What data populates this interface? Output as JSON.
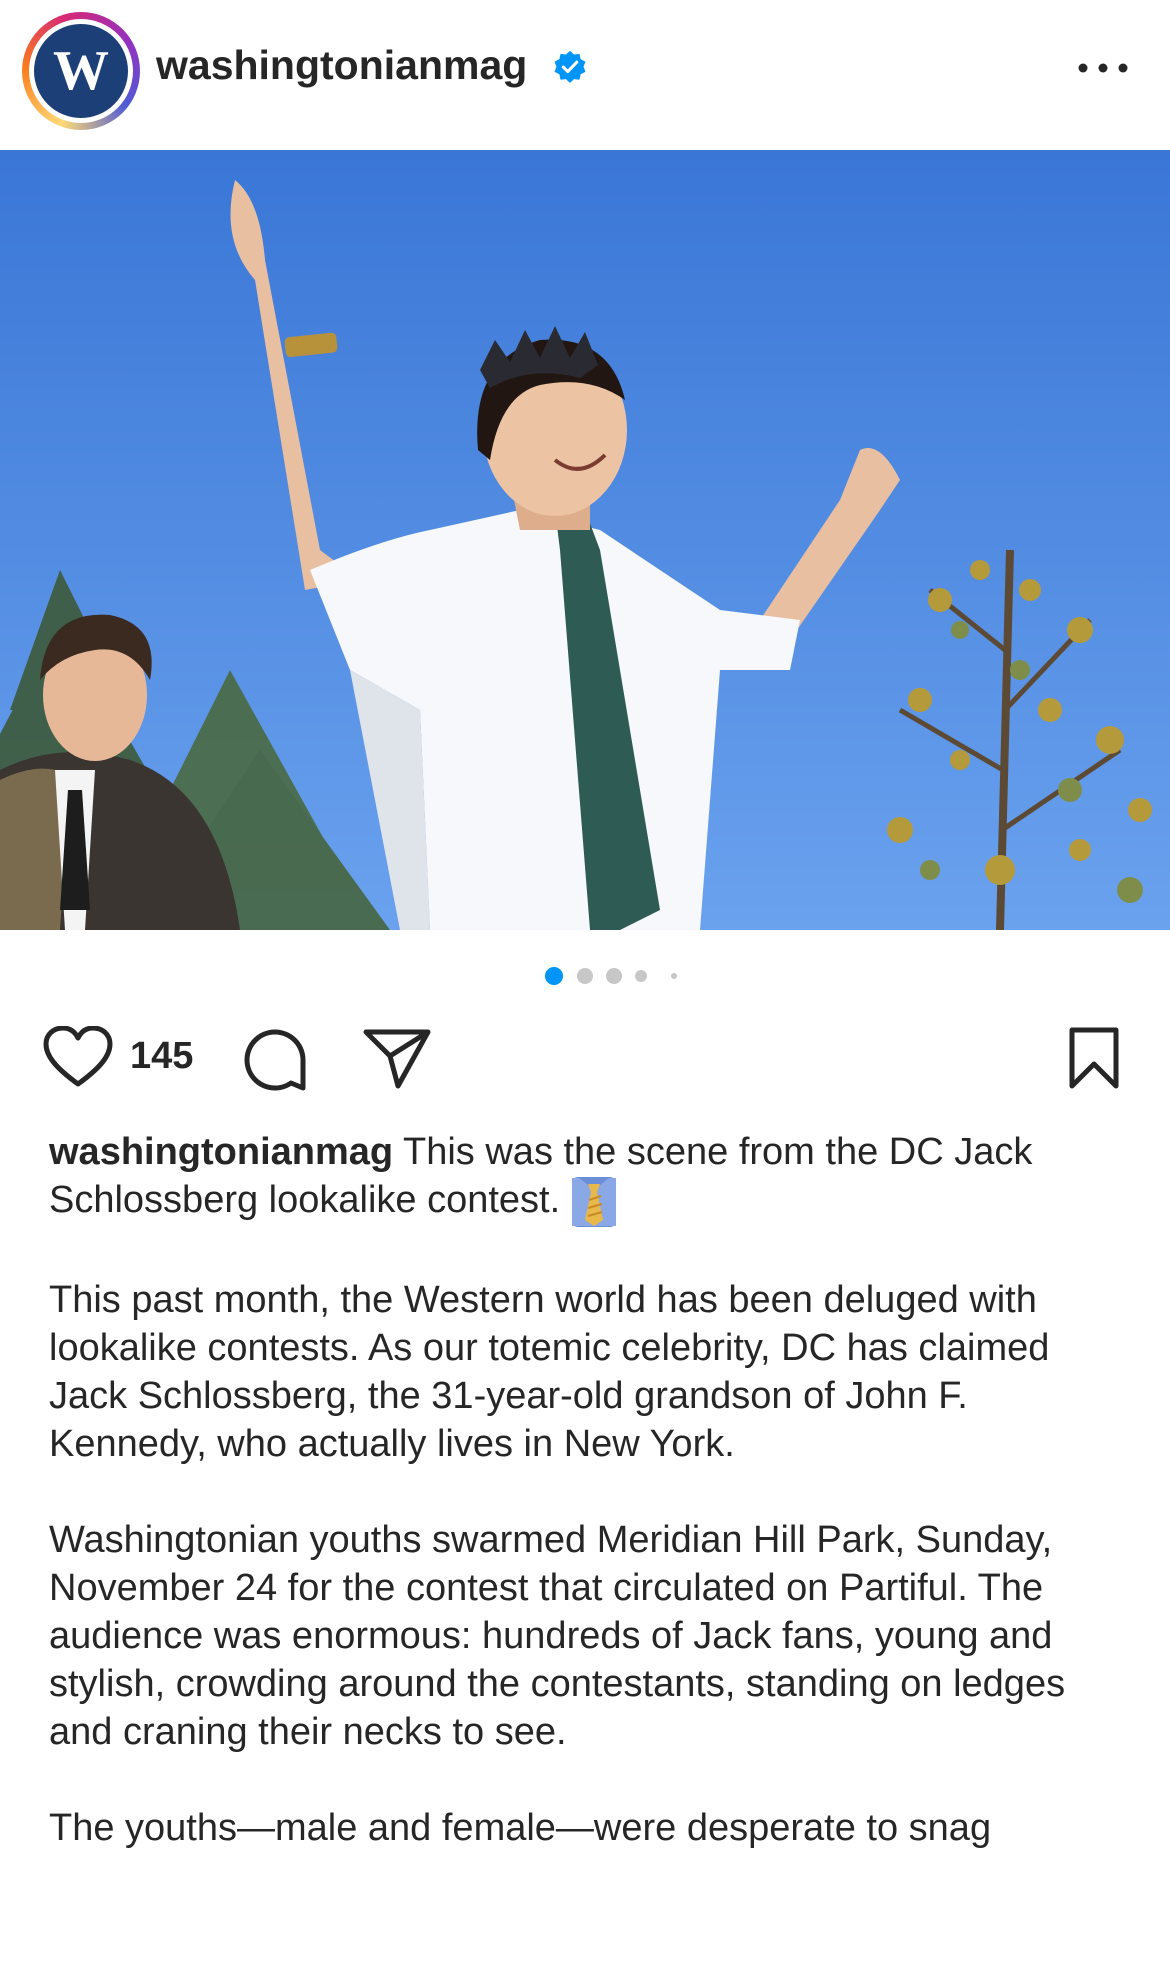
{
  "header": {
    "avatar_letter": "W",
    "username": "washingtonianmag",
    "verified_icon": "verified-badge-icon",
    "more_icon": "more-options-icon"
  },
  "carousel": {
    "total_dots": 5,
    "active_index": 0
  },
  "actions": {
    "like_icon": "heart-icon",
    "like_count": "145",
    "comment_icon": "comment-icon",
    "share_icon": "send-icon",
    "save_icon": "bookmark-icon"
  },
  "caption": {
    "username": "washingtonianmag",
    "first_line": "This was the scene from the DC Jack Schlossberg lookalike contest.",
    "emoji_icon": "necktie-emoji",
    "paragraph_2": "This past month, the Western world has been deluged with lookalike contests. As our totemic celebrity, DC has claimed Jack Schlossberg, the 31-year-old grandson of John F. Kennedy, who actually lives in New York.",
    "paragraph_3": "Washingtonian youths swarmed Meridian Hill Park, Sunday, November 24 for the contest that circulated on Partiful. The audience was enormous: hundreds of Jack fans, young and stylish, crowding around the contestants, standing on ledges and craning their necks to see.",
    "paragraph_4": "The youths—male and female—were desperate to snag"
  },
  "colors": {
    "accent_blue": "#0095f6",
    "text": "#262626",
    "brand_navy": "#1c3f78"
  }
}
